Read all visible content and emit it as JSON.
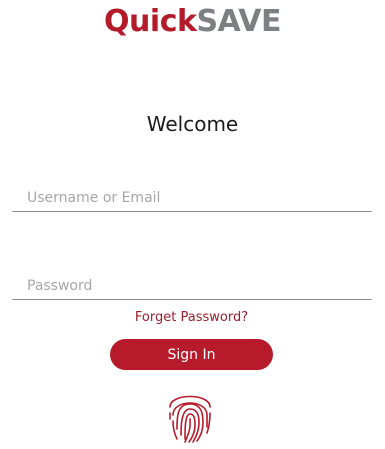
{
  "app": {
    "logo_part_a": "Quick",
    "logo_part_b": "SAVE"
  },
  "login": {
    "heading": "Welcome",
    "username": {
      "placeholder": "Username or Email",
      "value": ""
    },
    "password": {
      "placeholder": "Password",
      "value": ""
    },
    "forgot_label": "Forget Password?",
    "signin_label": "Sign In",
    "biometric_icon": "fingerprint-icon"
  },
  "colors": {
    "brand_red": "#b71b2b",
    "brand_gray": "#7d7f82",
    "link_red": "#9b1e2c",
    "underline_gray": "#8c8c8c"
  }
}
